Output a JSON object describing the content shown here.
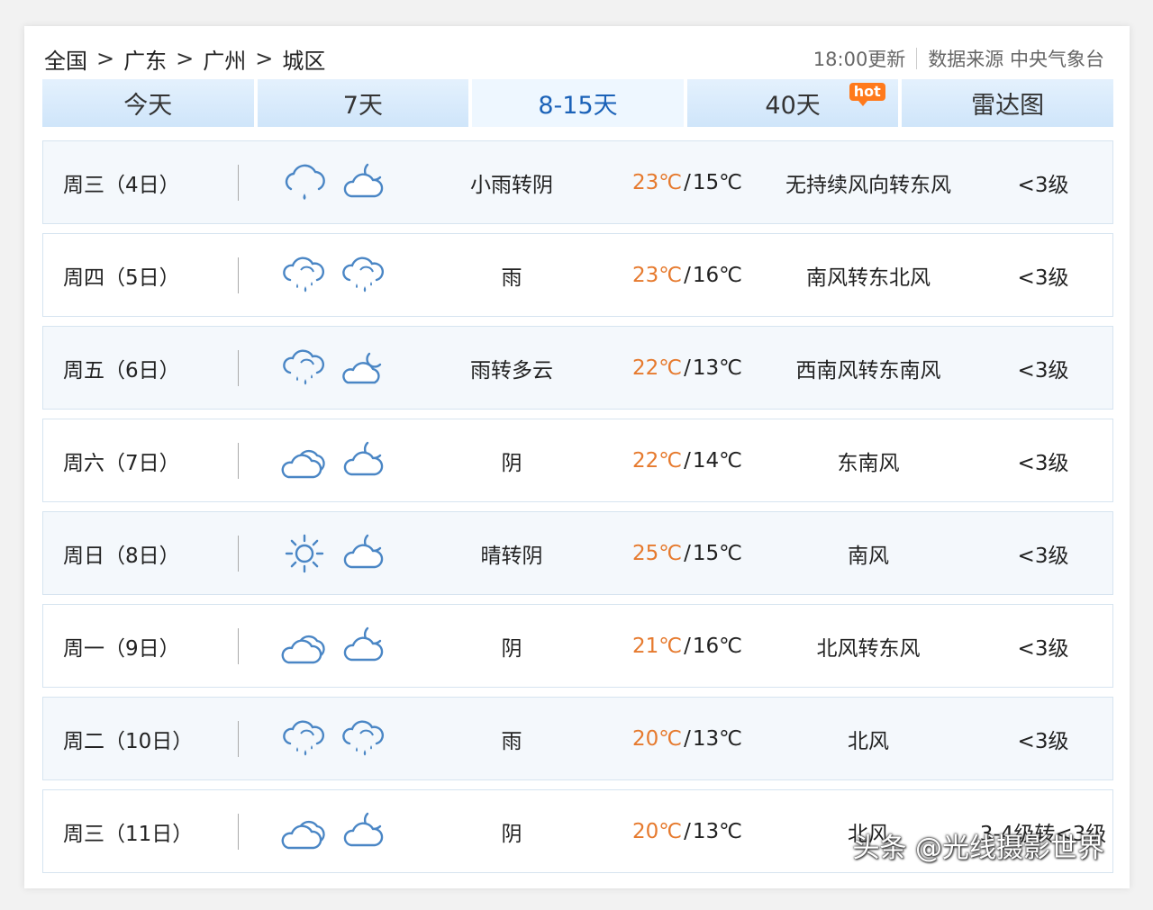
{
  "breadcrumb": [
    "全国",
    "广东",
    "广州",
    "城区"
  ],
  "breadcrumb_sep": ">",
  "update": "18:00更新",
  "source": "数据来源 中央气象台",
  "tabs": [
    {
      "label": "今天"
    },
    {
      "label": "7天"
    },
    {
      "label": "8-15天",
      "active": true
    },
    {
      "label": "40天",
      "badge": "hot"
    },
    {
      "label": "雷达图"
    }
  ],
  "temp_unit": "℃",
  "colors": {
    "accent": "#1b62b8",
    "high_temp": "#e67a2e",
    "icon": "#4a86c5"
  },
  "days": [
    {
      "day": "周三（4日）",
      "icon_day": "rain-light-icon",
      "icon_night": "cloudy-night-icon",
      "desc": "小雨转阴",
      "high": "23",
      "low": "15",
      "wind": "无持续风向转东风",
      "level": "<3级"
    },
    {
      "day": "周四（5日）",
      "icon_day": "rain-icon",
      "icon_night": "rain-icon",
      "desc": "雨",
      "high": "23",
      "low": "16",
      "wind": "南风转东北风",
      "level": "<3级"
    },
    {
      "day": "周五（6日）",
      "icon_day": "rain-icon",
      "icon_night": "partly-cloudy-night-icon",
      "desc": "雨转多云",
      "high": "22",
      "low": "13",
      "wind": "西南风转东南风",
      "level": "<3级"
    },
    {
      "day": "周六（7日）",
      "icon_day": "overcast-icon",
      "icon_night": "cloudy-night-icon",
      "desc": "阴",
      "high": "22",
      "low": "14",
      "wind": "东南风",
      "level": "<3级"
    },
    {
      "day": "周日（8日）",
      "icon_day": "sunny-icon",
      "icon_night": "cloudy-night-icon",
      "desc": "晴转阴",
      "high": "25",
      "low": "15",
      "wind": "南风",
      "level": "<3级"
    },
    {
      "day": "周一（9日）",
      "icon_day": "overcast-icon",
      "icon_night": "cloudy-night-icon",
      "desc": "阴",
      "high": "21",
      "low": "16",
      "wind": "北风转东风",
      "level": "<3级"
    },
    {
      "day": "周二（10日）",
      "icon_day": "rain-icon",
      "icon_night": "rain-icon",
      "desc": "雨",
      "high": "20",
      "low": "13",
      "wind": "北风",
      "level": "<3级"
    },
    {
      "day": "周三（11日）",
      "icon_day": "overcast-icon",
      "icon_night": "cloudy-night-icon",
      "desc": "阴",
      "high": "20",
      "low": "13",
      "wind": "北风",
      "level": "3-4级转<3级"
    }
  ],
  "watermark": "头条 @光线摄影世界"
}
